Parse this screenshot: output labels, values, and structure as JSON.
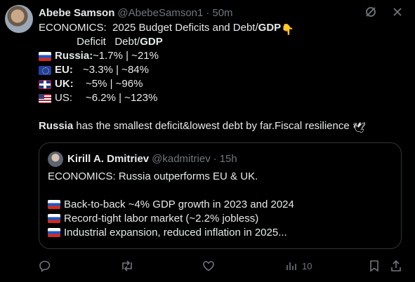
{
  "post": {
    "author_name": "Abebe Samson",
    "author_handle": "@AbebeSamson1",
    "separator": "·",
    "time": "50m",
    "lines": {
      "l1_text": "ECONOMICS:  2025 Budget Deficits and Debt/",
      "l1_bold": "GDP",
      "l1_emoji": "👇",
      "l2_text": "             Deficit   Debt/",
      "l2_bold": "GDP"
    },
    "rows": [
      {
        "flag": "russia-flag",
        "country": "Russia:",
        "values": " ~1.7% | ~21%",
        "bold": true
      },
      {
        "flag": "eu-flag",
        "country": "EU:",
        "values": "~3.3% | ~84%",
        "bold": true
      },
      {
        "flag": "uk-flag",
        "country": "UK:",
        "values": " ~5% | ~96%",
        "bold": true
      },
      {
        "flag": "us-flag",
        "country": "US:",
        "values": "~6.2% | ~123%",
        "bold": false
      }
    ],
    "summary_bold": "Russia",
    "summary_rest": " has the smallest deficit&lowest debt by far.Fiscal resilience ",
    "summary_emoji": "🕊"
  },
  "quote": {
    "author_name": "Kirill A. Dmitriev",
    "author_handle": "@kadmitriev",
    "separator": "·",
    "time": "15h",
    "line1": "ECONOMICS: Russia outperforms EU & UK.",
    "bullets": [
      "Back-to-back ~4% GDP growth in 2023 and 2024",
      "Record-tight labor market (~2.2% jobless)",
      "Industrial expansion, reduced inflation in 2025..."
    ]
  },
  "actions": {
    "reply": {
      "icon": "reply-icon",
      "count": ""
    },
    "repost": {
      "icon": "repost-icon",
      "count": ""
    },
    "like": {
      "icon": "heart-icon",
      "count": ""
    },
    "views": {
      "icon": "views-icon",
      "count": "10"
    },
    "bookmark": {
      "icon": "bookmark-icon",
      "count": ""
    },
    "share": {
      "icon": "share-icon",
      "count": ""
    }
  },
  "colors": {
    "background": "#000000",
    "text": "#e7e9ea",
    "muted": "#71767b",
    "border": "#2f3336"
  }
}
